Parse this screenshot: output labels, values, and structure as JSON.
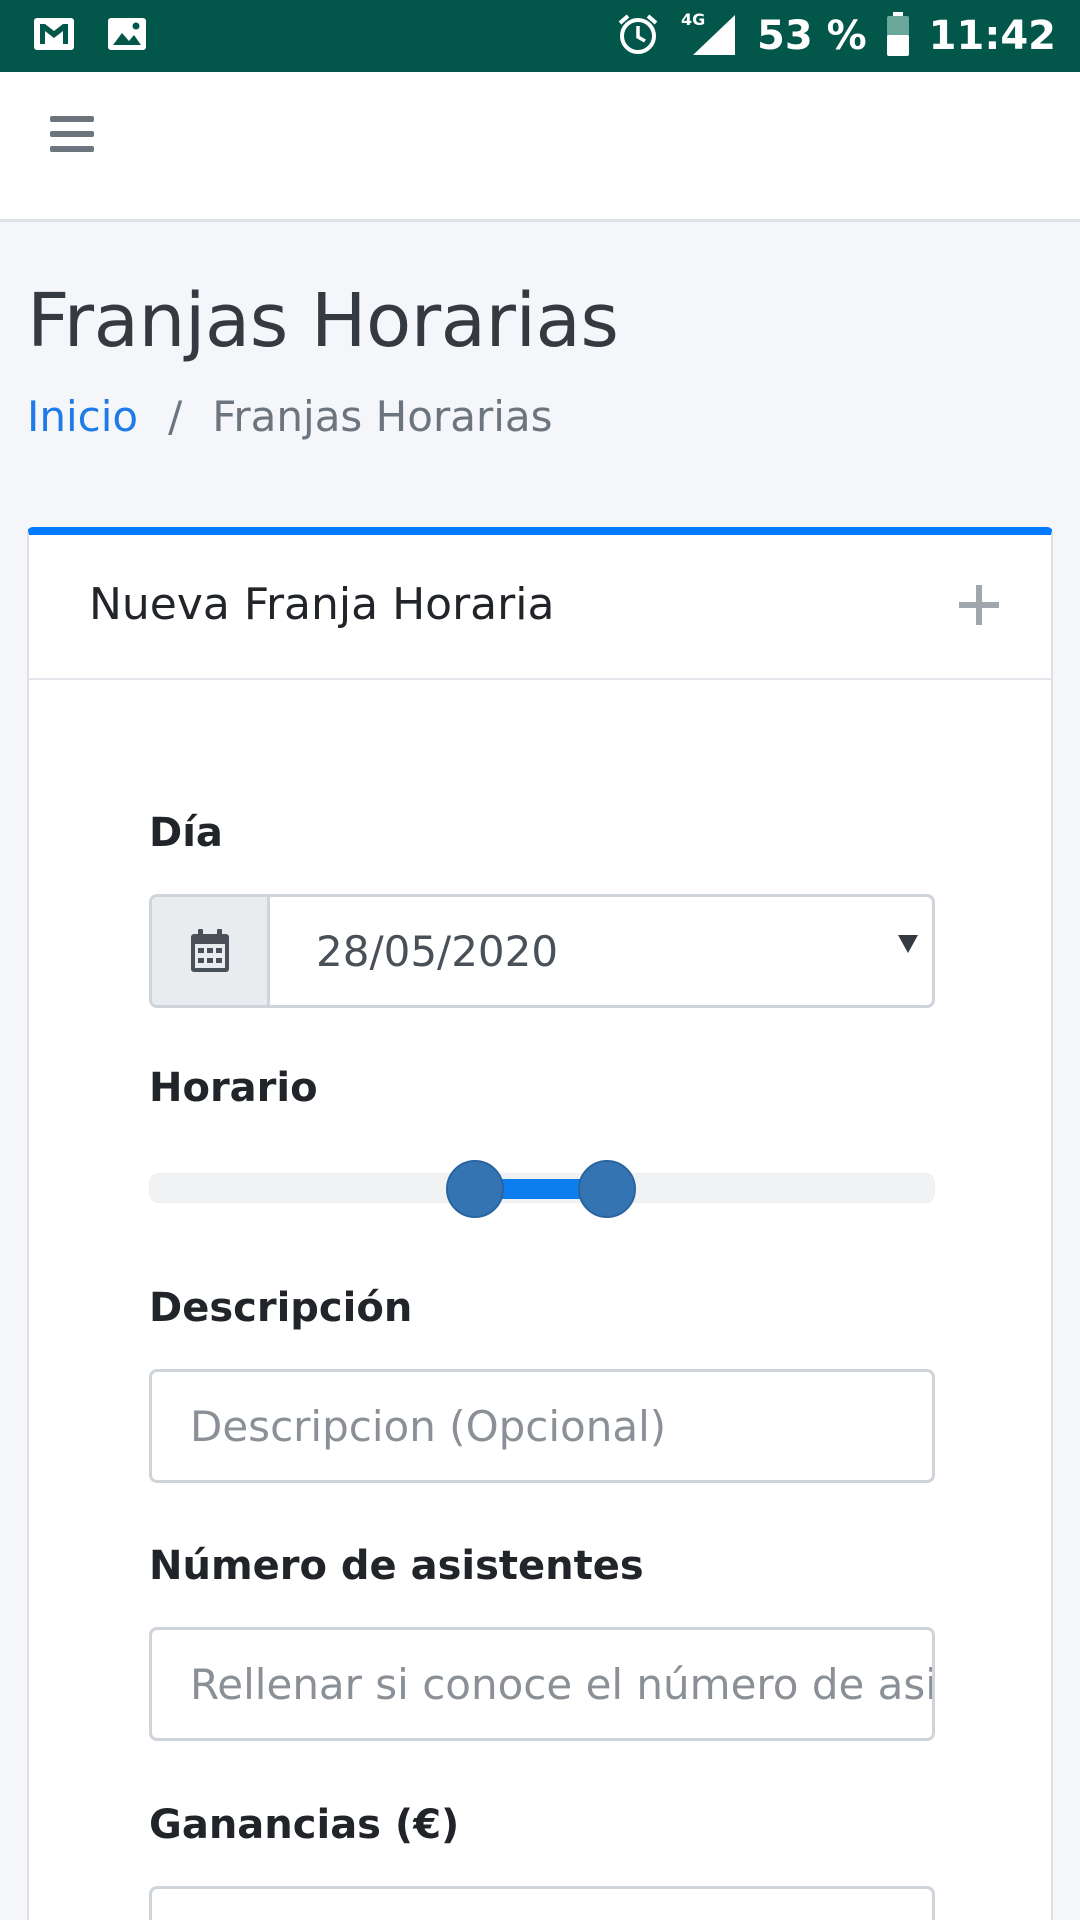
{
  "status_bar": {
    "icons_left": [
      "gmail-icon",
      "gallery-icon"
    ],
    "icons_right": [
      "alarm-icon",
      "signal-4g-icon",
      "battery-icon"
    ],
    "network": "4G",
    "battery": "53 %",
    "time": "11:42"
  },
  "navbar": {
    "menu_icon": "hamburger-menu-icon"
  },
  "page": {
    "title": "Franjas Horarias",
    "breadcrumb": {
      "home": "Inicio",
      "separator": "/",
      "current": "Franjas Horarias"
    }
  },
  "card": {
    "title": "Nueva Franja Horaria",
    "collapse_icon": "plus-icon",
    "accent_color": "#007bff",
    "form": {
      "day": {
        "label": "Día",
        "value": "28/05/2020",
        "icon": "calendar-icon"
      },
      "schedule": {
        "label": "Horario",
        "range_start": 0.415,
        "range_end": 0.583
      },
      "description": {
        "label": "Descripción",
        "placeholder": "Descripcion (Opcional)"
      },
      "attendees": {
        "label": "Número de asistentes",
        "placeholder": "Rellenar si conoce el número de asistentes"
      },
      "earnings": {
        "label": "Ganancias (€)"
      }
    }
  }
}
